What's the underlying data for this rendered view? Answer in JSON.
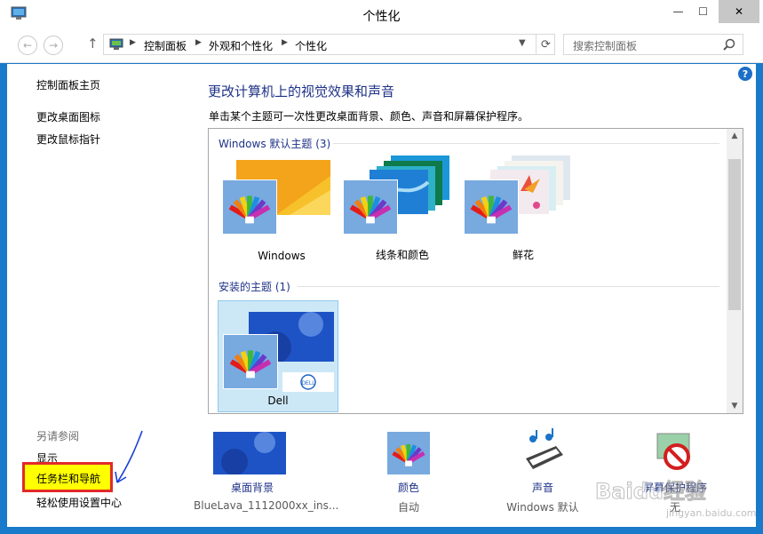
{
  "window": {
    "title": "个性化",
    "minimize": "—",
    "maximize": "☐",
    "close": "✕"
  },
  "address": {
    "back": "←",
    "forward": "→",
    "up": "↑",
    "crumbs": [
      "控制面板",
      "外观和个性化",
      "个性化"
    ],
    "search_placeholder": "搜索控制面板"
  },
  "sidebar": {
    "items": [
      "控制面板主页",
      "更改桌面图标",
      "更改鼠标指针"
    ],
    "see_also_title": "另请参阅",
    "see_also": [
      "显示",
      "任务栏和导航",
      "轻松使用设置中心"
    ]
  },
  "main": {
    "title": "更改计算机上的视觉效果和声音",
    "description": "单击某个主题可一次性更改桌面背景、颜色、声音和屏幕保护程序。"
  },
  "themes": {
    "default_group": "Windows 默认主题 (3)",
    "default_items": [
      "Windows",
      "线条和颜色",
      "鲜花"
    ],
    "installed_group": "安装的主题 (1)",
    "installed_items": [
      "Dell"
    ],
    "selected": "Dell"
  },
  "bottom": {
    "desktop_background": {
      "label": "桌面背景",
      "value": "BlueLava_1112000xx_ins..."
    },
    "color": {
      "label": "颜色",
      "value": "自动"
    },
    "sound": {
      "label": "声音",
      "value": "Windows 默认"
    },
    "screensaver": {
      "label": "屏幕保护程序",
      "value": "无"
    }
  },
  "watermark": {
    "text": "Baidu经验",
    "sub": "jingyan.baidu.com"
  },
  "colors": {
    "link": "#1e3287",
    "highlight": "#ffff00",
    "highlight_border": "#e22a2a",
    "selected_theme": "#cce8f7"
  }
}
